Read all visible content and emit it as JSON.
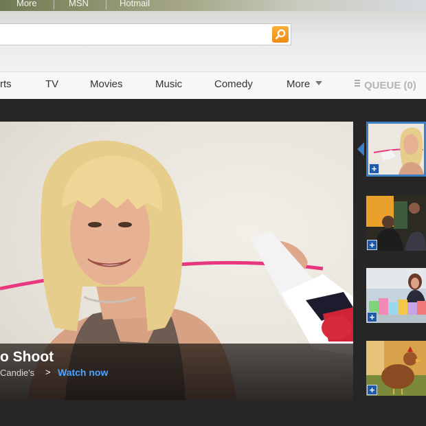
{
  "topbar": {
    "links": [
      "More",
      "MSN",
      "Hotmail"
    ]
  },
  "search": {
    "value": "",
    "placeholder": ""
  },
  "nav": {
    "items": [
      "rts",
      "TV",
      "Movies",
      "Music",
      "Comedy"
    ],
    "more_label": "More",
    "queue_label": "QUEUE (0)"
  },
  "hero": {
    "title": "o Shoot",
    "subtitle": "Candie's",
    "arrow": ">",
    "watch_label": "Watch now"
  },
  "thumbnails": [
    {
      "plus": "+"
    },
    {
      "plus": "+"
    },
    {
      "plus": "+"
    },
    {
      "plus": "+"
    }
  ],
  "colors": {
    "accent_blue": "#3a7fc8",
    "search_orange": "#f29a1f",
    "watch_link": "#4ea3ff"
  }
}
